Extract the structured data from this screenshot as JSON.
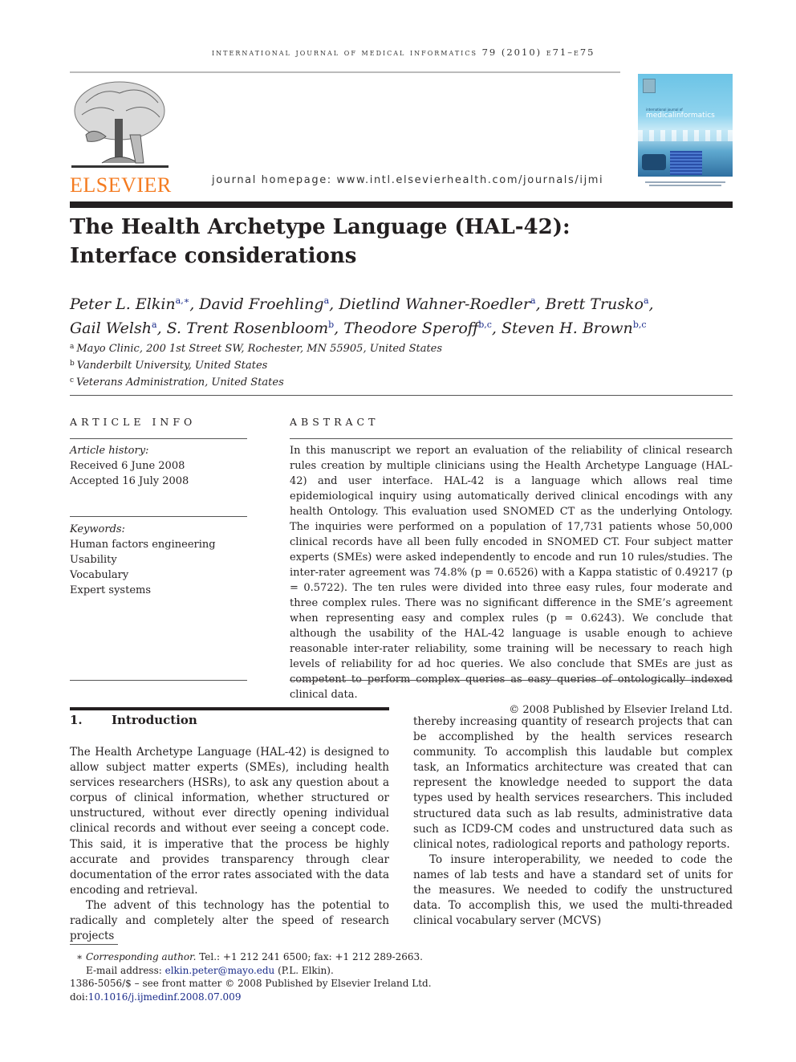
{
  "header": {
    "running_head": "international journal of medical informatics 79 (2010) e71–e75",
    "publisher_logo_text": "ELSEVIER",
    "homepage": "journal homepage: www.intl.elsevierhealth.com/journals/ijmi",
    "cover_title_small": "international journal of",
    "cover_title": "medicalinformatics"
  },
  "article": {
    "title_line1": "The Health Archetype Language (HAL-42):",
    "title_line2": "Interface considerations",
    "authors": [
      {
        "name": "Peter L. Elkin",
        "sup": "a,∗"
      },
      {
        "name": "David Froehling",
        "sup": "a"
      },
      {
        "name": "Dietlind Wahner-Roedler",
        "sup": "a"
      },
      {
        "name": "Brett Trusko",
        "sup": "a"
      },
      {
        "name": "Gail Welsh",
        "sup": "a"
      },
      {
        "name": "S. Trent Rosenbloom",
        "sup": "b"
      },
      {
        "name": "Theodore Speroff",
        "sup": "b,c"
      },
      {
        "name": "Steven H. Brown",
        "sup": "b,c"
      }
    ],
    "affiliations": [
      {
        "mark": "a",
        "text": "Mayo Clinic, 200 1st Street SW, Rochester, MN 55905, United States"
      },
      {
        "mark": "b",
        "text": "Vanderbilt University, United States"
      },
      {
        "mark": "c",
        "text": "Veterans Administration, United States"
      }
    ]
  },
  "article_info": {
    "heading": "ARTICLE INFO",
    "history_label": "Article history:",
    "received": "Received 6 June 2008",
    "accepted": "Accepted 16 July 2008",
    "keywords_label": "Keywords:",
    "keywords": [
      "Human factors engineering",
      "Usability",
      "Vocabulary",
      "Expert systems"
    ]
  },
  "abstract": {
    "heading": "ABSTRACT",
    "text": "In this manuscript we report an evaluation of the reliability of clinical research rules creation by multiple clinicians using the Health Archetype Language (HAL-42) and user interface. HAL-42 is a language which allows real time epidemiological inquiry using automatically derived clinical encodings with any health Ontology. This evaluation used SNOMED CT as the underlying Ontology. The inquiries were performed on a population of 17,731 patients whose 50,000 clinical records have all been fully encoded in SNOMED CT. Four subject matter experts (SMEs) were asked independently to encode and run 10 rules/studies. The inter-rater agreement was 74.8% (p = 0.6526) with a Kappa statistic of 0.49217 (p = 0.5722). The ten rules were divided into three easy rules, four moderate and three complex rules. There was no significant difference in the SME’s agreement when representing easy and complex rules (p = 0.6243). We conclude that although the usability of the HAL-42 language is usable enough to achieve reasonable inter-rater reliability, some training will be necessary to reach high levels of reliability for ad hoc queries. We also conclude that SMEs are just as competent to perform complex queries as easy queries of ontologically indexed clinical data.",
    "copyright": "© 2008 Published by Elsevier Ireland Ltd."
  },
  "introduction": {
    "number": "1.",
    "heading": "Introduction",
    "left_p1": "The Health Archetype Language (HAL-42) is designed to allow subject matter experts (SMEs), including health services researchers (HSRs), to ask any question about a corpus of clinical information, whether structured or unstructured, without ever directly opening individual clinical records and without ever seeing a concept code. This said, it is imperative that the process be highly accurate and provides transparency through clear documentation of the error rates associated with the data encoding and retrieval.",
    "left_p2": "The advent of this technology has the potential to radically and completely alter the speed of research projects",
    "right_p1": "thereby increasing quantity of research projects that can be accomplished by the health services research community. To accomplish this laudable but complex task, an Informatics architecture was created that can represent the knowledge needed to support the data types used by health services researchers. This included structured data such as lab results, administrative data such as ICD9-CM codes and unstructured data such as clinical notes, radiological reports and pathology reports.",
    "right_p2": "To insure interoperability, we needed to code the names of lab tests and have a standard set of units for the measures. We needed to codify the unstructured data. To accomplish this, we used the multi-threaded clinical vocabulary server (MCVS)"
  },
  "footnotes": {
    "star": "∗",
    "corresponding_label": "Corresponding author.",
    "contact": " Tel.: +1 212 241 6500; fax: +1 212 289-2663.",
    "email_label": "E-mail address: ",
    "email": "elkin.peter@mayo.edu",
    "email_suffix": " (P.L. Elkin).",
    "issn": "1386-5056/$ – see front matter © 2008 Published by Elsevier Ireland Ltd.",
    "doi_label": "doi:",
    "doi": "10.1016/j.ijmedinf.2008.07.009"
  },
  "colors": {
    "elsevier_orange": "#f47b20",
    "link_blue": "#1a2b8a"
  }
}
